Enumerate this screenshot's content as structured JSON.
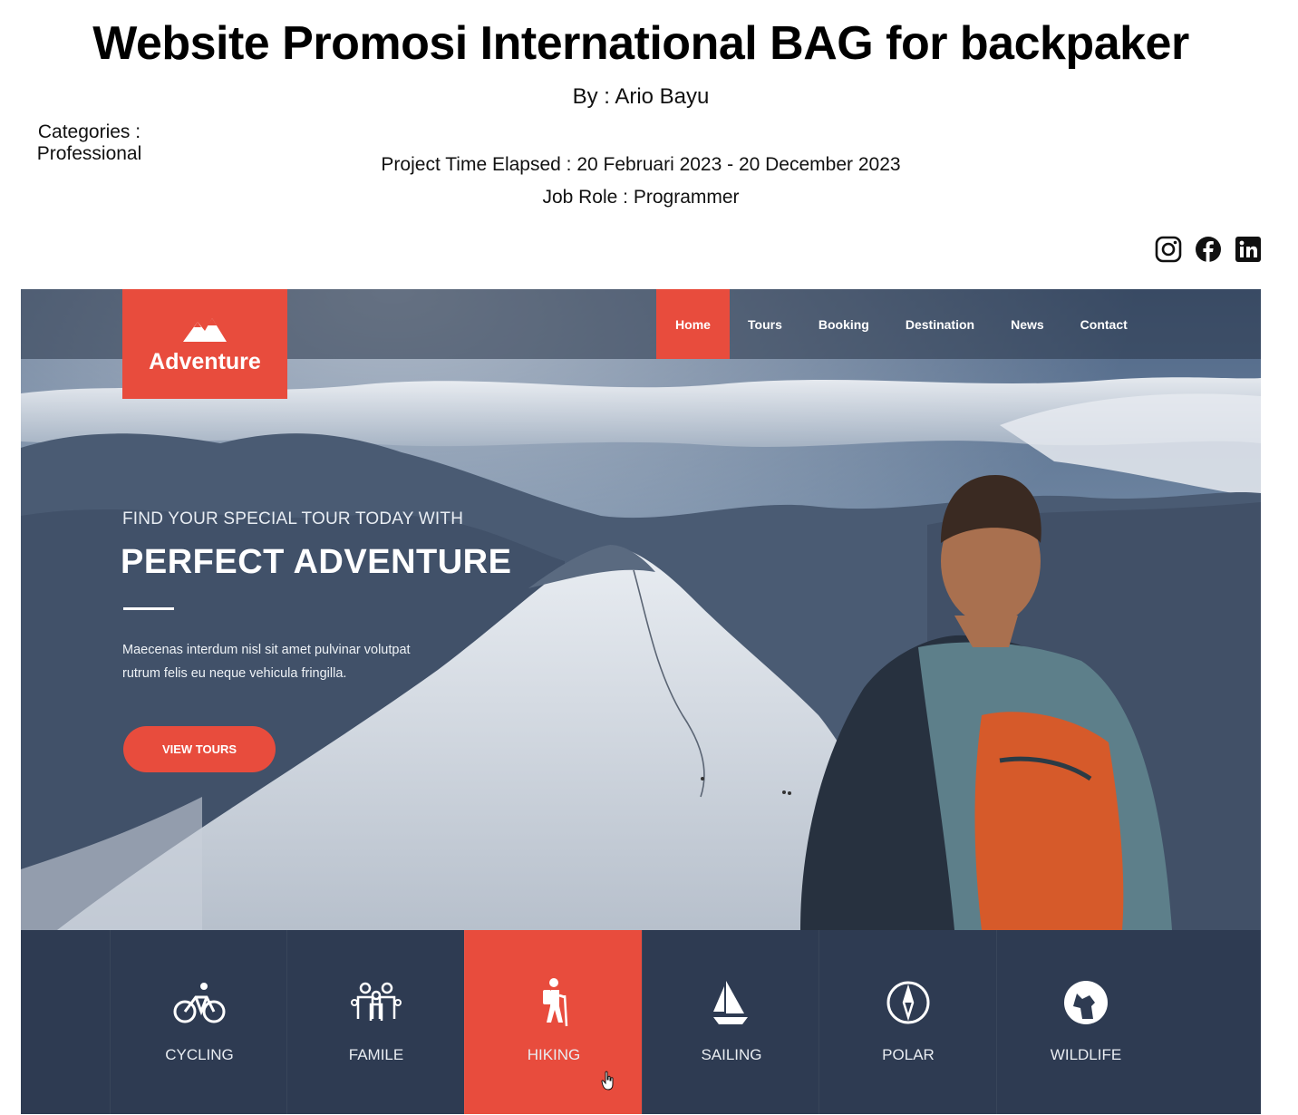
{
  "header": {
    "title": "Website Promosi International BAG for backpaker",
    "author": "By : Ario Bayu",
    "categories": "Categories : Professional",
    "time": "Project Time Elapsed : 20 Februari 2023 - 20 December 2023",
    "role": "Job Role : Programmer"
  },
  "social": [
    "instagram-icon",
    "facebook-icon",
    "linkedin-icon"
  ],
  "site": {
    "logo_text": "Adventure",
    "nav": [
      "Home",
      "Tours",
      "Booking",
      "Destination",
      "News",
      "Contact"
    ],
    "active_nav": "Home",
    "hero_subtitle": "FIND YOUR SPECIAL TOUR TODAY WITH",
    "hero_title": "PERFECT ADVENTURE",
    "hero_desc_line1": "Maecenas interdum nisl sit amet pulvinar volutpat",
    "hero_desc_line2": "rutrum felis eu neque vehicula fringilla.",
    "cta_label": "VIEW TOURS",
    "categories": [
      {
        "label": "CYCLING",
        "icon": "bicycle-icon"
      },
      {
        "label": "FAMILE",
        "icon": "family-icon"
      },
      {
        "label": "HIKING",
        "icon": "hiker-icon"
      },
      {
        "label": "SAILING",
        "icon": "sailboat-icon"
      },
      {
        "label": "POLAR",
        "icon": "compass-icon"
      },
      {
        "label": "WILDLIFE",
        "icon": "wolf-icon"
      }
    ],
    "active_category": "HIKING"
  },
  "colors": {
    "accent": "#e84c3d",
    "navy": "#2e3b52"
  }
}
